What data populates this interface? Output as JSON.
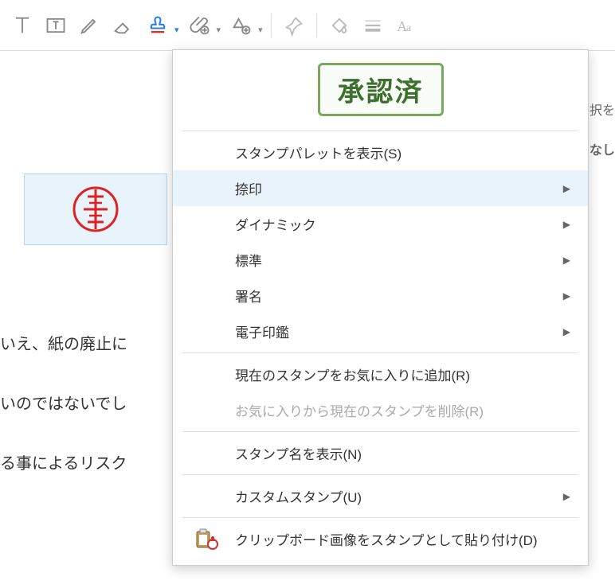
{
  "dropdown": {
    "approved_label": "承認済",
    "items": {
      "show_palette": "スタンプパレットを表示(S)",
      "seal": "捺印",
      "dynamic": "ダイナミック",
      "standard": "標準",
      "signature": "署名",
      "eseal": "電子印鑑",
      "fav_add": "現在のスタンプをお気に入りに追加(R)",
      "fav_remove": "お気に入りから現在のスタンプを削除(R)",
      "show_name": "スタンプ名を表示(N)",
      "custom": "カスタムスタンプ(U)",
      "clipboard": "クリップボード画像をスタンプとして貼り付け(D)"
    }
  },
  "doc": {
    "line1": "いえ、紙の廃止に",
    "line2": "いのではないでし",
    "line3": "る事によるリスク"
  },
  "right_cut_1": "択を",
  "right_cut_2": "なし"
}
